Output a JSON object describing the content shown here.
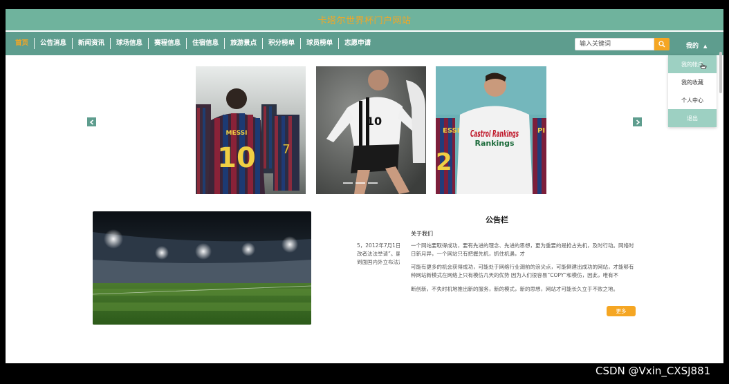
{
  "header": {
    "site_title": "卡塔尔世界杯门户网站"
  },
  "nav": {
    "items": [
      {
        "label": "首页",
        "active": true
      },
      {
        "label": "公告消息"
      },
      {
        "label": "新闻资讯"
      },
      {
        "label": "球场信息"
      },
      {
        "label": "赛程信息"
      },
      {
        "label": "住宿信息"
      },
      {
        "label": "旅游景点"
      },
      {
        "label": "积分榜单"
      },
      {
        "label": "球员榜单"
      },
      {
        "label": "志愿申请"
      }
    ]
  },
  "search": {
    "placeholder": "输入关键词",
    "icon": "search-icon"
  },
  "user_menu": {
    "label": "我的",
    "dropdown": [
      {
        "label": "我的帐户"
      },
      {
        "label": "我的收藏"
      },
      {
        "label": "个人中心"
      },
      {
        "label": "退出"
      }
    ]
  },
  "carousel": {
    "slides": [
      {
        "jersey_name": "MESSI",
        "jersey_number": "10"
      },
      {
        "jersey_number": "10"
      },
      {
        "shirt_text": "Castrol Rankings"
      }
    ]
  },
  "notice": {
    "title": "公告栏",
    "about_title": "关于我们",
    "left_fragment_1": "5，2012年7月1日",
    "left_fragment_2": "改者法法举请”。届",
    "left_fragment_3": "到面国内外立布法定",
    "line1": "一个网站要取得成功，要有先进的理念、先进的思想，更为重要的是抢占先机，及时行动。网络时",
    "line2": "日新月异，一个网站只有把握先机，抓住机遇，才",
    "line3": "可能有更多的机会获得成功，可能处于网络行业潮前的浪尖点，可能倒建出成功的网站，才能够有",
    "line4": "种网站新模式在网络上只有模仿几天的优势 因为人们很容易“COPY”和模仿，因此，唯有不",
    "line5": "断创新，不失时机地推出新的服务，新的模式，新的思想，网站才可能长久立于不败之地。",
    "more_label": "更多"
  },
  "watermark": "CSDN @Vxin_CXSJ881",
  "colors": {
    "primary": "#5e9d8e",
    "topbar": "#6fb39d",
    "accent": "#f5a623"
  }
}
